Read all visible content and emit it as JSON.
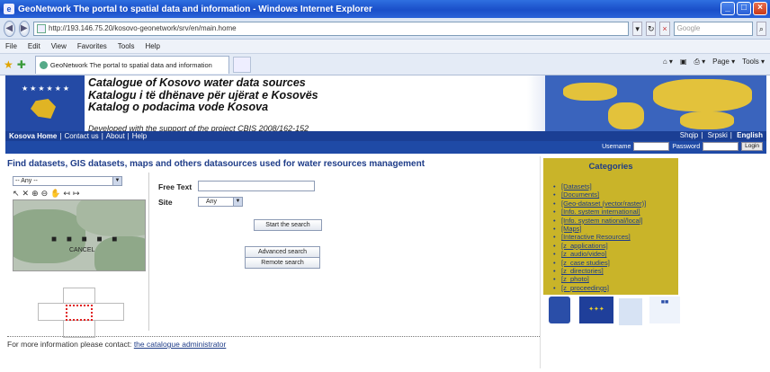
{
  "window": {
    "title": "GeoNetwork  The portal to spatial data and information - Windows Internet Explorer",
    "minimize": "_",
    "maximize": "□",
    "close": "×"
  },
  "address": {
    "url": "http://193.146.75.20/kosovo-geonetwork/srv/en/main.home",
    "search_placeholder": "Google"
  },
  "menu": [
    "File",
    "Edit",
    "View",
    "Favorites",
    "Tools",
    "Help"
  ],
  "tab": {
    "label": "GeoNetwork  The portal to spatial data and information",
    "commands": [
      "Page ▾",
      "Tools ▾"
    ]
  },
  "banner": {
    "line1": "Catalogue of Kosovo water data sources",
    "line2": "Katalogu i të dhënave për ujërat e Kosovës",
    "line3": "Katalog o podacima vode Kosova",
    "sub": "Developed with the support of the project CBIS 2008/162-152"
  },
  "nav": {
    "links": [
      "Kosova Home",
      "Contact us",
      "About",
      "Help"
    ],
    "languages": [
      "Shqip",
      "Srpski",
      "English"
    ],
    "username_label": "Username",
    "password_label": "Password",
    "login_button": "Login"
  },
  "heading": "Find datasets, GIS datasets, maps and others datasources used for water resources management",
  "search": {
    "region_select": "-- Any --",
    "free_text_label": "Free Text",
    "free_text_value": "",
    "site_label": "Site",
    "site_select": "Any",
    "start_button": "Start the search",
    "advanced_button": "Advanced search",
    "remote_button": "Remote search",
    "map_cancel": "CANCEL",
    "map_dots": "■ ■ ■ ■ ■"
  },
  "categories": {
    "title": "Categories",
    "items": [
      "[Datasets]",
      "[Documents]",
      "[Geo-dataset (vector/raster)]",
      "[Info. system international]",
      "[Info. system national/local]",
      "[Maps]",
      "[Interactive Resources]",
      "[z_applications]",
      "[z_audio/video]",
      "[z_case studies]",
      "[z_directories]",
      "[z_photo]",
      "[z_proceedings]"
    ]
  },
  "footer": {
    "text": "For more information please contact:",
    "link": "the catalogue administrator"
  },
  "colors": {
    "banner_blue": "#244aa5",
    "nav_blue": "#1b3f94",
    "category_gold": "#c9b429",
    "link_blue": "#1e3c88"
  }
}
